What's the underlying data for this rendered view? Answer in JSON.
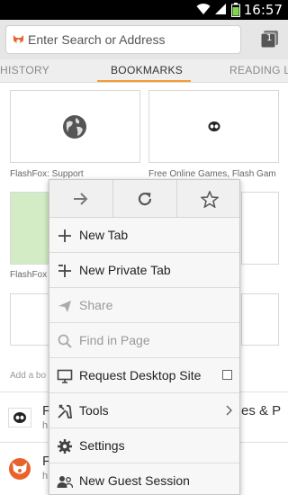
{
  "status_bar": {
    "time": "16:57"
  },
  "toolbar": {
    "url_placeholder": "Enter Search or Address",
    "tab_count": "1"
  },
  "page_tabs": [
    {
      "label": "HISTORY"
    },
    {
      "label": "BOOKMARKS"
    },
    {
      "label": "READING LI"
    }
  ],
  "thumbnails": [
    {
      "label": "FlashFox: Support"
    },
    {
      "label": "Free Online Games, Flash Gam"
    },
    {
      "label": "FlashFox"
    },
    {
      "label": ""
    }
  ],
  "add_bookmark_hint": "Add a bo",
  "list_rows": [
    {
      "title": "F",
      "subtitle": "h",
      "right_text": "es & P"
    },
    {
      "title": "F",
      "subtitle": "h"
    }
  ],
  "menu": {
    "nav": {
      "forward_icon": "forward-arrow-icon",
      "reload_icon": "reload-icon",
      "bookmark_icon": "star-icon"
    },
    "items": [
      {
        "label": "New Tab",
        "icon": "plus-icon"
      },
      {
        "label": "New Private Tab",
        "icon": "private-plus-icon"
      },
      {
        "label": "Share",
        "icon": "share-icon",
        "disabled": true
      },
      {
        "label": "Find in Page",
        "icon": "search-icon",
        "disabled": true
      },
      {
        "label": "Request Desktop Site",
        "icon": "monitor-icon",
        "checkbox": false
      },
      {
        "label": "Tools",
        "icon": "tools-icon",
        "submenu": true
      },
      {
        "label": "Settings",
        "icon": "gear-icon"
      },
      {
        "label": "New Guest Session",
        "icon": "guest-icon"
      }
    ]
  },
  "colors": {
    "accent": "#f39c2f",
    "status_bar": "#000000",
    "toolbar": "#e6e6e6"
  }
}
